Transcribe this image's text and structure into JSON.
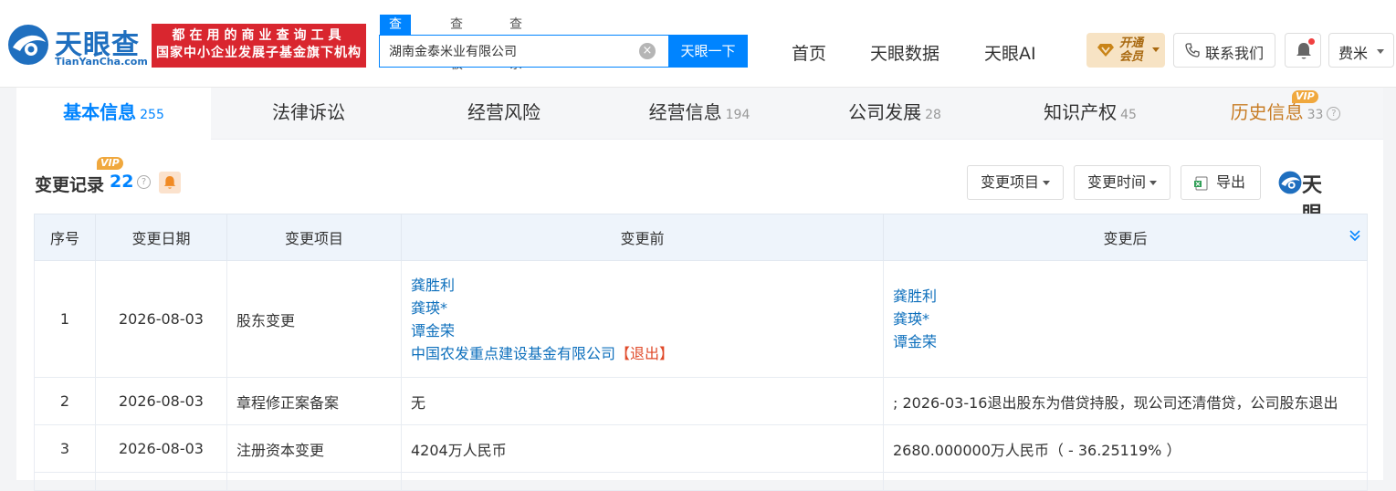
{
  "header": {
    "logo": {
      "cn": "天眼查",
      "en": "TianYanCha.com"
    },
    "promo": {
      "line1": "都在用的商业查询工具",
      "line2": "国家中小企业发展子基金旗下机构"
    },
    "search_tabs": [
      "查公司",
      "查老板",
      "查关系"
    ],
    "search_value": "湖南金泰米业有限公司",
    "search_button": "天眼一下",
    "nav": [
      "首页",
      "天眼数据",
      "天眼AI"
    ],
    "vip": {
      "line1": "开通",
      "line2": "会员"
    },
    "contact": "联系我们",
    "user": "费米",
    "colors": {
      "accent": "#0084ff",
      "promo": "#d9262f",
      "vip": "#f7e3c4"
    }
  },
  "tabs": [
    {
      "label": "基本信息",
      "count": "255"
    },
    {
      "label": "法律诉讼",
      "count": ""
    },
    {
      "label": "经营风险",
      "count": ""
    },
    {
      "label": "经营信息",
      "count": "194"
    },
    {
      "label": "公司发展",
      "count": "28"
    },
    {
      "label": "知识产权",
      "count": "45"
    },
    {
      "label": "历史信息",
      "count": "33",
      "badge": "VIP"
    }
  ],
  "section": {
    "title": "变更记录",
    "count": "22",
    "badge": "VIP",
    "filter_item": "变更项目",
    "filter_time": "变更时间",
    "export": "导出",
    "watermark": "天眼查"
  },
  "table": {
    "headers": [
      "序号",
      "变更日期",
      "变更项目",
      "变更前",
      "变更后"
    ],
    "rows": [
      {
        "no": "1",
        "date": "2026-08-03",
        "item": "股东变更",
        "before": [
          "龚胜利",
          "龚瑛*",
          "谭金荣",
          "中国农发重点建设基金有限公司"
        ],
        "before_tag": "【退出】",
        "after": [
          "龚胜利",
          "龚瑛*",
          "谭金荣"
        ]
      },
      {
        "no": "2",
        "date": "2026-08-03",
        "item": "章程修正案备案",
        "before_text": "无",
        "after_text": "; 2026-03-16退出股东为借贷持股，现公司还清借贷，公司股东退出"
      },
      {
        "no": "3",
        "date": "2026-08-03",
        "item": "注册资本变更",
        "before_text": "4204万人民币",
        "after_text": "2680.000000万人民币（ - 36.25119% ）"
      }
    ]
  }
}
